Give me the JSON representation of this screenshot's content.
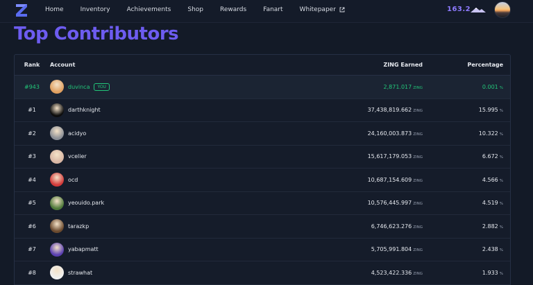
{
  "nav": {
    "links": [
      "Home",
      "Inventory",
      "Achievements",
      "Shop",
      "Rewards",
      "Fanart",
      "Whitepaper"
    ],
    "balance": "163.2"
  },
  "page": {
    "title": "Top Contributors"
  },
  "table": {
    "headers": {
      "rank": "Rank",
      "account": "Account",
      "earned": "ZING Earned",
      "pct": "Percentage"
    },
    "unit": "ZING",
    "pct_unit": "%",
    "you_badge": "YOU",
    "rows": [
      {
        "rank": "#943",
        "name": "duvinca",
        "earned": "2,871.017",
        "pct": "0.001",
        "avatar": "#e0a060"
      },
      {
        "rank": "#1",
        "name": "darthknight",
        "earned": "37,438,819.662",
        "pct": "15.995",
        "avatar": "#0d0d0d"
      },
      {
        "rank": "#2",
        "name": "acidyo",
        "earned": "24,160,003.873",
        "pct": "10.322",
        "avatar": "#8b8f96"
      },
      {
        "rank": "#3",
        "name": "vcelier",
        "earned": "15,617,179.053",
        "pct": "6.672",
        "avatar": "#d8b6a4"
      },
      {
        "rank": "#4",
        "name": "ocd",
        "earned": "10,687,154.609",
        "pct": "4.566",
        "avatar": "#d23a3a"
      },
      {
        "rank": "#5",
        "name": "yeouido.park",
        "earned": "10,576,445.997",
        "pct": "4.519",
        "avatar": "#4f7a3a"
      },
      {
        "rank": "#6",
        "name": "tarazkp",
        "earned": "6,746,623.276",
        "pct": "2.882",
        "avatar": "#6b4a2e"
      },
      {
        "rank": "#7",
        "name": "yabapmatt",
        "earned": "5,705,991.804",
        "pct": "2.438",
        "avatar": "#5a3fb0"
      },
      {
        "rank": "#8",
        "name": "strawhat",
        "earned": "4,523,422.336",
        "pct": "1.933",
        "avatar": "#f0f0f0"
      }
    ]
  }
}
